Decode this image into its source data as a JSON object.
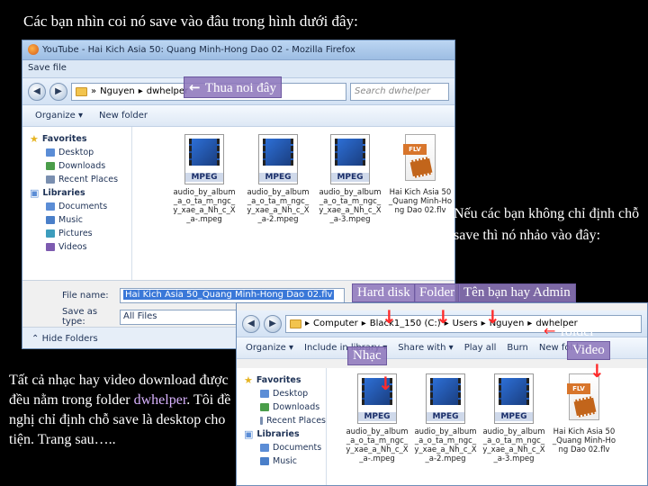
{
  "slide": {
    "title": "Các bạn nhìn coi nó save vào đâu trong hình dưới đây:",
    "note_right": "Nếu các bạn không chỉ định chỗ save thì nó nhảo vào đây:",
    "note_left_prefix": "Tất cả nhạc hay video download được đều nằm trong folder ",
    "note_left_highlight": "dwhelper",
    "note_left_suffix": ". Tôi đề nghị chỉ định chỗ save là desktop cho tiện. Trang sau….."
  },
  "callouts": {
    "thua_noi_day": "Thua noi đây",
    "hard_disk": "Hard disk",
    "folder": "Folder",
    "ten_ban_hay_admin": "Tên bạn hay Admin",
    "folder_video_1": "folder",
    "folder_video_2": "Video",
    "nhac": "Nhạc"
  },
  "save_dialog": {
    "window_title": "YouTube - Hai Kich Asia 50: Quang Minh-Hong Dao 02 - Mozilla Firefox",
    "dialog_title": "Save file",
    "address": [
      "Nguyen",
      "dwhelper"
    ],
    "search_placeholder": "Search dwhelper",
    "toolbar": {
      "organize": "Organize ▾",
      "new_folder": "New folder"
    },
    "sidebar": [
      {
        "label": "Favorites",
        "type": "hdr"
      },
      {
        "label": "Desktop",
        "type": "sub"
      },
      {
        "label": "Downloads",
        "type": "sub"
      },
      {
        "label": "Recent Places",
        "type": "sub"
      },
      {
        "label": "Libraries",
        "type": "hdr"
      },
      {
        "label": "Documents",
        "type": "sub"
      },
      {
        "label": "Music",
        "type": "sub"
      },
      {
        "label": "Pictures",
        "type": "sub"
      },
      {
        "label": "Videos",
        "type": "sub"
      }
    ],
    "files": [
      {
        "name": "audio_by_album_a_o_ta_m_ngc_y_xae_a_Nh_c_X_a-.mpeg",
        "kind": "mpeg"
      },
      {
        "name": "audio_by_album_a_o_ta_m_ngc_y_xae_a_Nh_c_X_a-2.mpeg",
        "kind": "mpeg"
      },
      {
        "name": "audio_by_album_a_o_ta_m_ngc_y_xae_a_Nh_c_X_a-3.mpeg",
        "kind": "mpeg"
      },
      {
        "name": "Hai Kich Asia 50_Quang Minh-Hong Dao 02.flv",
        "kind": "flv"
      }
    ],
    "file_name_label": "File name:",
    "file_name_value": "Hai Kich Asia 50_Quang Minh-Hong Dao 02.flv",
    "save_type_label": "Save as type:",
    "save_type_value": "All Files",
    "hide_folders": "Hide Folders"
  },
  "explorer": {
    "address": [
      "Computer",
      "Black1_150 (C:)",
      "Users",
      "Nguyen",
      "dwhelper"
    ],
    "toolbar": [
      "Organize ▾",
      "Include in library ▾",
      "Share with ▾",
      "Play all",
      "Burn",
      "New folder"
    ],
    "sidebar": [
      {
        "label": "Favorites",
        "type": "hdr"
      },
      {
        "label": "Desktop",
        "type": "sub"
      },
      {
        "label": "Downloads",
        "type": "sub"
      },
      {
        "label": "Recent Places",
        "type": "sub"
      },
      {
        "label": "Libraries",
        "type": "hdr"
      },
      {
        "label": "Documents",
        "type": "sub"
      },
      {
        "label": "Music",
        "type": "sub"
      }
    ],
    "files": [
      {
        "name": "audio_by_album_a_o_ta_m_ngc_y_xae_a_Nh_c_X_a-.mpeg",
        "kind": "mpeg"
      },
      {
        "name": "audio_by_album_a_o_ta_m_ngc_y_xae_a_Nh_c_X_a-2.mpeg",
        "kind": "mpeg"
      },
      {
        "name": "audio_by_album_a_o_ta_m_ngc_y_xae_a_Nh_c_X_a-3.mpeg",
        "kind": "mpeg"
      },
      {
        "name": "Hai Kich Asia 50_Quang Minh-Hong Dao 02.flv",
        "kind": "flv"
      }
    ]
  },
  "colors": {
    "callout_bg": "#8e77bc",
    "arrow": "#ff2a2a",
    "highlight_text": "#d9b3ff"
  }
}
